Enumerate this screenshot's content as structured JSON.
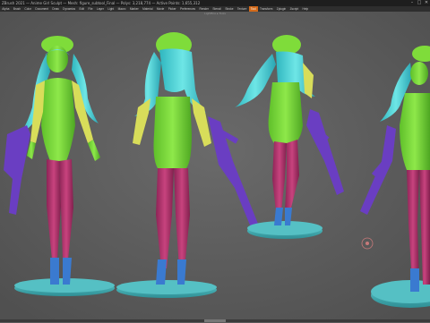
{
  "window": {
    "title": "ZBrush 2021 — Anime Girl Sculpt — Mesh: figure_subtool_Final — Polys: 3,218,774 — Active Points: 1,655,312",
    "controls": [
      "–",
      "□",
      "✕"
    ]
  },
  "menubar": {
    "items": [
      "Alpha",
      "Brush",
      "Color",
      "Document",
      "Draw",
      "Dynamics",
      "Edit",
      "File",
      "Layer",
      "Light",
      "Macro",
      "Marker",
      "Material",
      "Movie",
      "Picker",
      "Preferences",
      "Render",
      "Stencil",
      "Stroke",
      "Texture",
      "Tool",
      "Transform",
      "Zplugin",
      "Zscript",
      "Help"
    ],
    "active_index": 20
  },
  "canvas": {
    "center_label": "LightBox ▸ Tools"
  },
  "colors": {
    "background": "#5b5b5b",
    "skin": "#7fdc3a",
    "hair": "#4fd6d6",
    "stockings": "#b3346f",
    "boots": "#3a7ad0",
    "bases": "#45b3b8",
    "jacket": "#d8dd5a",
    "rifle": "#6a3ec2",
    "accent": "#d36a1a"
  },
  "icons": [
    "rotate-gizmo-icon"
  ]
}
